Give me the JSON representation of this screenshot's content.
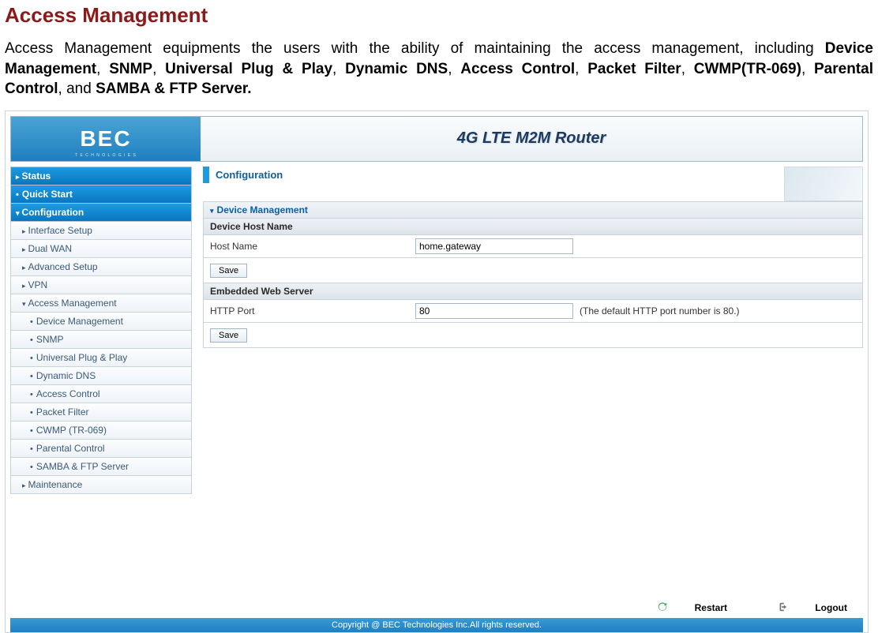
{
  "heading": "Access Management",
  "intro_parts": {
    "lead": "Access Management equipments the users with the ability of maintaining the access management, including ",
    "b1": "Device Management",
    "s1": ", ",
    "b2": "SNMP",
    "s2": ", ",
    "b3": "Universal Plug & Play",
    "s3": ", ",
    "b4": "Dynamic DNS",
    "s4": ", ",
    "b5": "Access Control",
    "s5": ", ",
    "b6": "Packet Filter",
    "s6": ", ",
    "b7": "CWMP(TR-069)",
    "s7": ", ",
    "b8": "Parental Control",
    "s8": ", and ",
    "b9": "SAMBA & FTP Server."
  },
  "banner": {
    "logo": "BEC",
    "logo_sub": "T E C H N O L O G I E S",
    "title": "4G LTE M2M Router"
  },
  "sidebar": {
    "status": "Status",
    "quick_start": "Quick Start",
    "configuration": "Configuration",
    "interface_setup": "Interface Setup",
    "dual_wan": "Dual WAN",
    "advanced_setup": "Advanced Setup",
    "vpn": "VPN",
    "access_mgmt": "Access Management",
    "am_device": "Device Management",
    "am_snmp": "SNMP",
    "am_upnp": "Universal Plug & Play",
    "am_ddns": "Dynamic DNS",
    "am_ac": "Access Control",
    "am_pf": "Packet Filter",
    "am_cwmp": "CWMP (TR-069)",
    "am_parental": "Parental Control",
    "am_samba": "SAMBA & FTP Server",
    "maintenance": "Maintenance"
  },
  "content": {
    "panel_title": "Configuration",
    "section": "Device Management",
    "sub1": "Device Host Name",
    "hostname_label": "Host Name",
    "hostname_value": "home.gateway",
    "save": "Save",
    "sub2": "Embedded Web Server",
    "httpport_label": "HTTP Port",
    "httpport_value": "80",
    "httpport_hint": "(The default HTTP port number is 80.)"
  },
  "footer": {
    "restart": "Restart",
    "logout": "Logout",
    "copyright": "Copyright @ BEC Technologies Inc.All rights reserved."
  }
}
